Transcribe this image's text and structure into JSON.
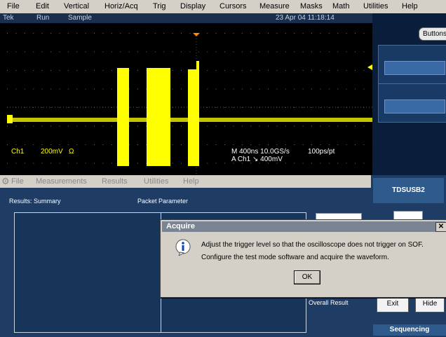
{
  "menu": [
    "File",
    "Edit",
    "Vertical",
    "Horiz/Acq",
    "Trig",
    "Display",
    "Cursors",
    "Measure",
    "Masks",
    "Math",
    "Utilities",
    "Help"
  ],
  "status": {
    "brand": "Tek",
    "run": "Run",
    "mode": "Sample",
    "datetime": "23 Apr 04 11:18:14"
  },
  "right_panel": {
    "button": "Buttons"
  },
  "readouts": {
    "channel": "Ch1",
    "scale": "200mV",
    "ohm": "Ω",
    "timebase": "M 400ns 10.0GS/s",
    "resolution": "100ps/pt",
    "trigger": "A  Ch1  ↘  400mV"
  },
  "colors": {
    "trace": "#ffff00",
    "screen": "#000000",
    "app_bg": "#1e3c64",
    "sidebar_header": "#2f5a8c"
  },
  "app_menu": [
    "File",
    "Measurements",
    "Results",
    "Utilities",
    "Help"
  ],
  "results": {
    "summary_label": "Results: Summary",
    "param_label": "Packet Parameter",
    "overall": "Overall Result"
  },
  "sidebar": {
    "title": "TDSUSB2",
    "exit": "Exit",
    "hide": "Hide",
    "sequencing": "Sequencing"
  },
  "dialog": {
    "title": "Acquire",
    "line1": "Adjust the trigger level so that the oscilloscope does not trigger on SOF.",
    "line2": "Configure the test mode software and acquire the waveform.",
    "ok": "OK",
    "icon": "info-icon"
  }
}
